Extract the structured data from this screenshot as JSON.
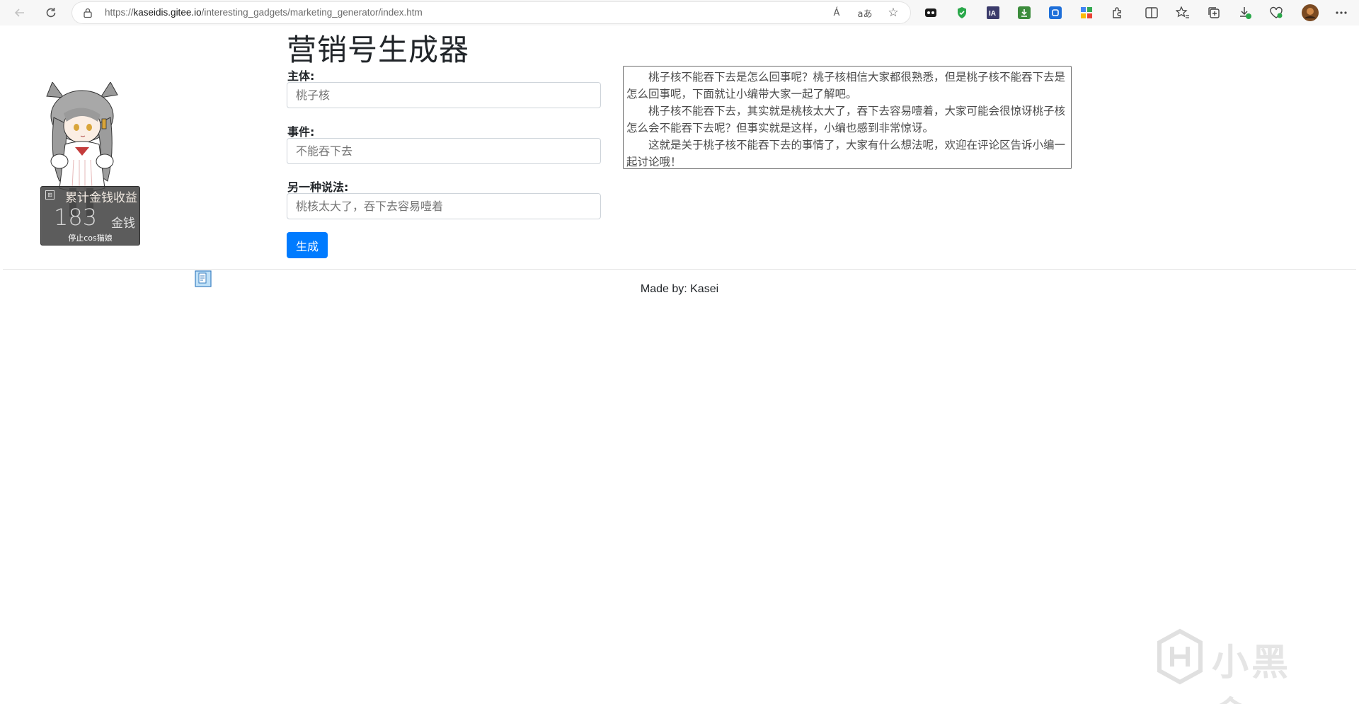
{
  "browser": {
    "url_prefix": "https://",
    "url_host": "kaseidis.gitee.io",
    "url_path": "/interesting_gadgets/marketing_generator/index.htm",
    "icons": {
      "back": "arrow-left-icon",
      "refresh": "refresh-icon",
      "read_aloud": "read-aloud-icon",
      "translate": "translate-icon",
      "favorite": "star-icon"
    },
    "read_aloud_glyph": "Á",
    "translate_glyph": "aあ"
  },
  "mascot": {
    "panel_title": "累计金钱收益",
    "count": "183",
    "unit": "金钱",
    "stop_label": "停止cos猫娘"
  },
  "page": {
    "title": "营销号生成器",
    "subject_label": "主体:",
    "subject_placeholder": "桃子核",
    "event_label": "事件:",
    "event_placeholder": "不能吞下去",
    "alt_label": "另一种说法:",
    "alt_placeholder": "桃核太大了，吞下去容易噎着",
    "generate_button": "生成",
    "output": [
      "桃子核不能吞下去是怎么回事呢？桃子核相信大家都很熟悉，但是桃子核不能吞下去是怎么回事呢，下面就让小编带大家一起了解吧。",
      "桃子核不能吞下去，其实就是桃核太大了，吞下去容易噎着，大家可能会很惊讶桃子核怎么会不能吞下去呢？但事实就是这样，小编也感到非常惊讶。",
      "这就是关于桃子核不能吞下去的事情了，大家有什么想法呢，欢迎在评论区告诉小编一起讨论哦！"
    ],
    "footer": "Made by: Kasei"
  },
  "watermark": "小黑盒",
  "colors": {
    "primary": "#007bff",
    "chrome_bg": "#f7f7f7",
    "text": "#212529"
  }
}
